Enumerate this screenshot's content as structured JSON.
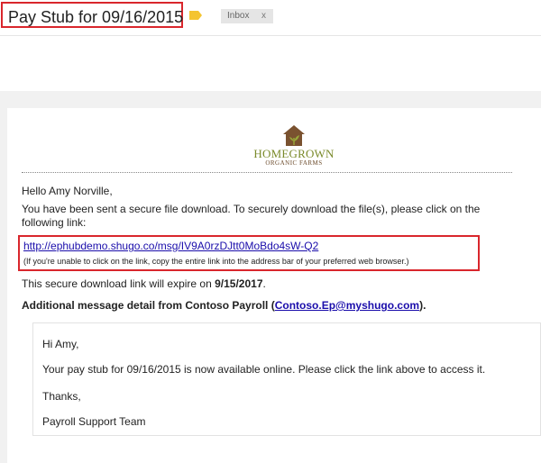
{
  "header": {
    "subject": "Pay Stub for 09/16/2015",
    "label_chip": "Inbox",
    "label_remove": "x"
  },
  "logo": {
    "name": "HOMEGROWN",
    "tagline": "ORGANIC FARMS"
  },
  "message": {
    "greeting": "Hello Amy Norville,",
    "intro_line1": "You have been sent a secure file download. To securely download the file(s), please click on the",
    "intro_line2": "following link:",
    "link_url": "http://ephubdemo.shugo.co/msg/IV9A0rzDJtt0MoBdo4sW-Q2",
    "link_note": "(If you're unable to click on the link, copy the entire link into the address bar of your preferred web browser.)",
    "expire_prefix": "This secure download link will expire on ",
    "expire_date": "9/15/2017",
    "expire_suffix": ".",
    "additional_prefix": "Additional message detail from Contoso Payroll (",
    "sender_email": "Contoso.Ep@myshugo.com",
    "additional_suffix": ")."
  },
  "quoted": {
    "greeting": "Hi Amy,",
    "body": "Your pay stub for 09/16/2015 is now available online.  Please click the link above to access it.",
    "thanks": "Thanks,",
    "signature": "Payroll Support Team"
  },
  "colors": {
    "highlight_border": "#d9262c",
    "link": "#1a0dab",
    "label_tag": "#f4c430",
    "logo_green": "#7a8a2a",
    "logo_brown": "#6b4a2a"
  }
}
